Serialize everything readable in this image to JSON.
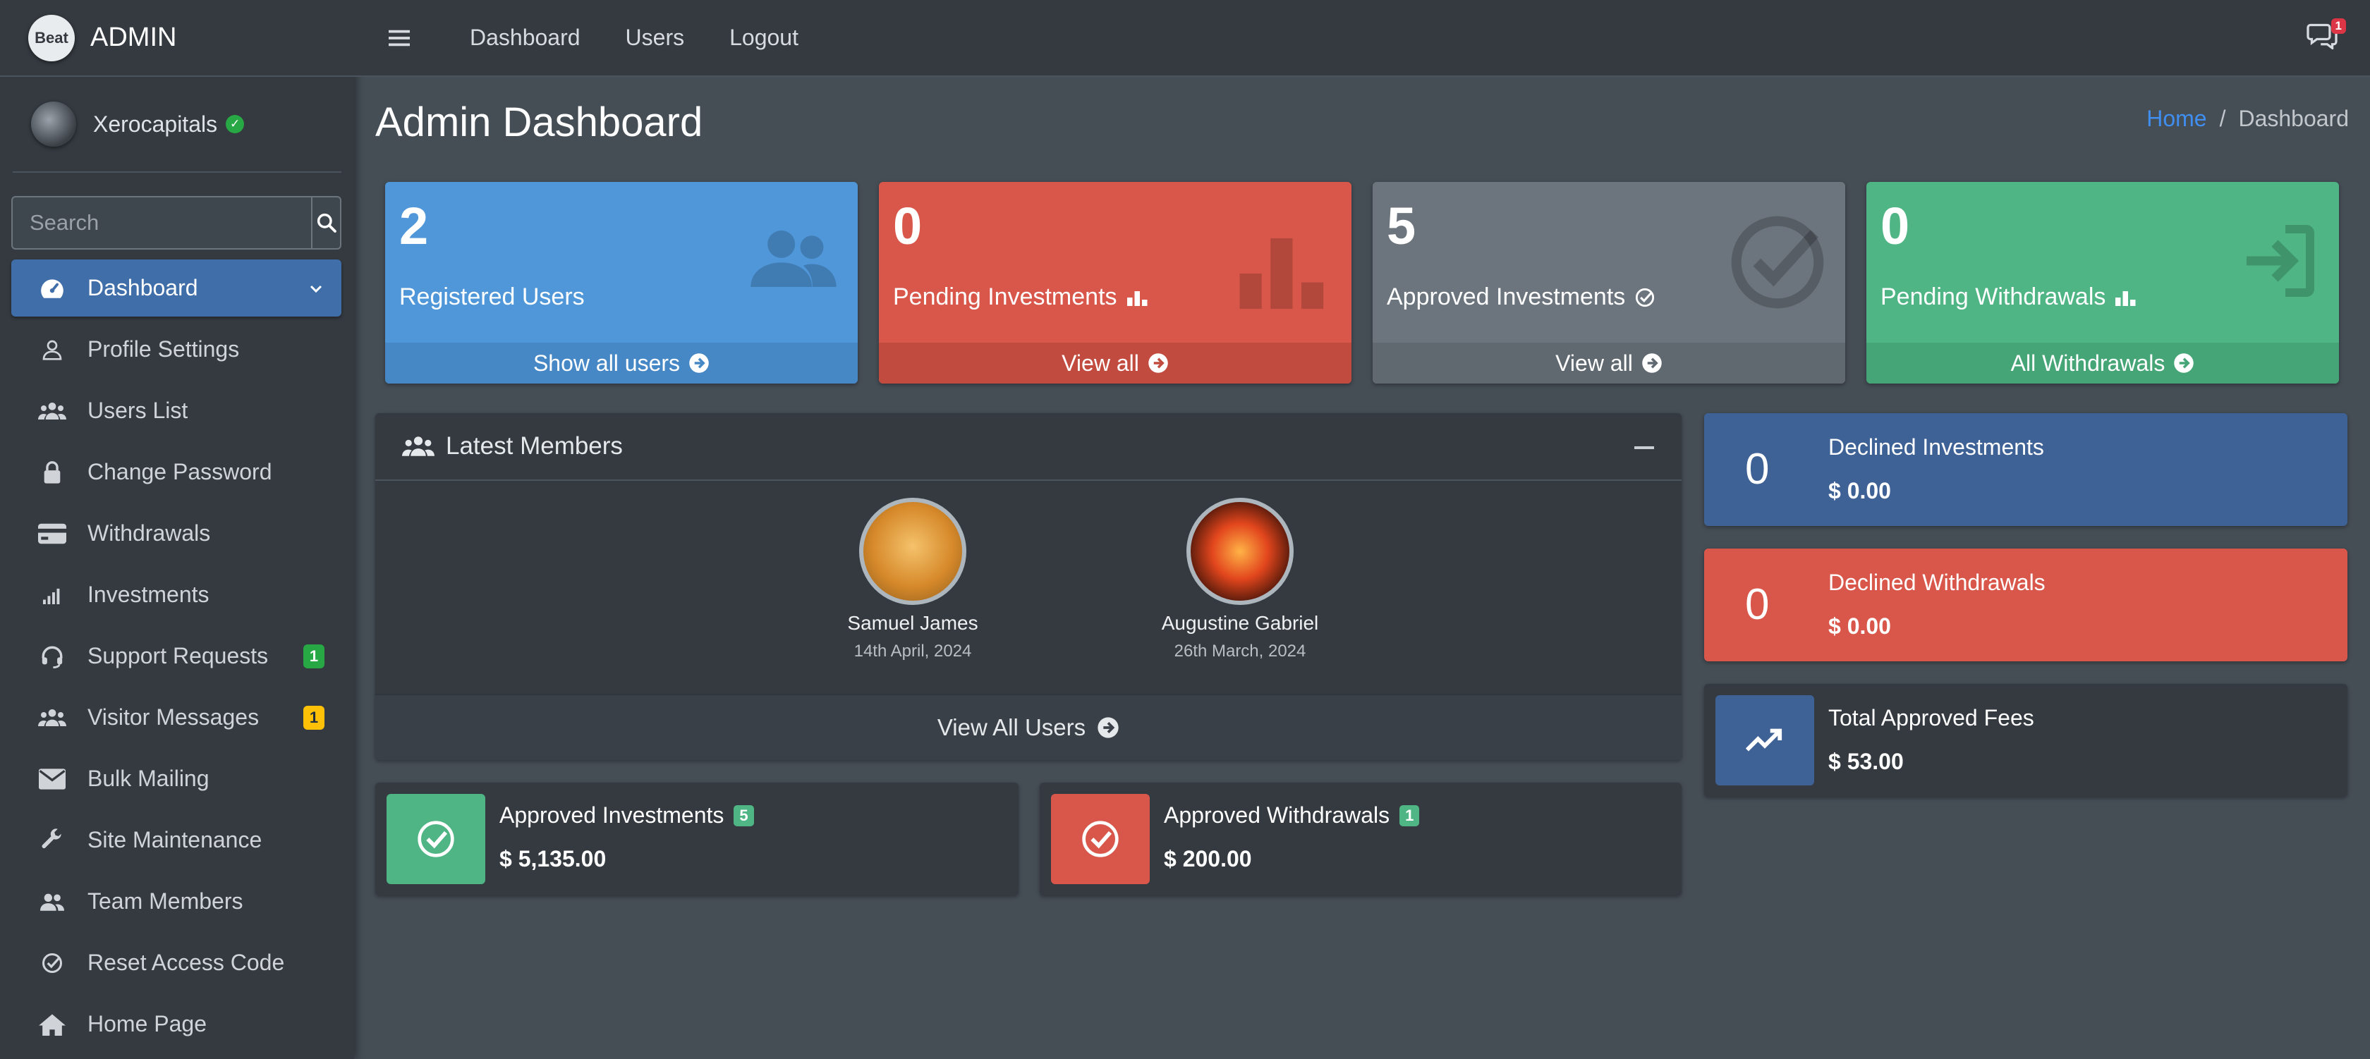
{
  "brand": {
    "logo_text": "Beat",
    "title": "ADMIN"
  },
  "user": {
    "name": "Xerocapitals"
  },
  "search": {
    "placeholder": "Search"
  },
  "sidebar": {
    "items": [
      {
        "label": "Dashboard",
        "icon": "tachometer-icon"
      },
      {
        "label": "Profile Settings",
        "icon": "user-icon"
      },
      {
        "label": "Users List",
        "icon": "users-icon"
      },
      {
        "label": "Change Password",
        "icon": "lock-icon"
      },
      {
        "label": "Withdrawals",
        "icon": "credit-card-icon"
      },
      {
        "label": "Investments",
        "icon": "signal-icon"
      },
      {
        "label": "Support Requests",
        "icon": "headset-icon",
        "badge": "1"
      },
      {
        "label": "Visitor Messages",
        "icon": "users-icon",
        "badge": "1"
      },
      {
        "label": "Bulk Mailing",
        "icon": "envelope-icon"
      },
      {
        "label": "Site Maintenance",
        "icon": "wrench-icon"
      },
      {
        "label": "Team Members",
        "icon": "team-icon"
      },
      {
        "label": "Reset Access Code",
        "icon": "check-circle-icon"
      },
      {
        "label": "Home Page",
        "icon": "home-icon"
      }
    ]
  },
  "topbar": {
    "links": [
      "Dashboard",
      "Users",
      "Logout"
    ],
    "messages_badge": "1"
  },
  "page": {
    "title": "Admin Dashboard",
    "breadcrumb_home": "Home",
    "breadcrumb_sep": "/",
    "breadcrumb_current": "Dashboard"
  },
  "stats": [
    {
      "value": "2",
      "label": "Registered Users",
      "footer": "Show all users",
      "color": "#4f97d9"
    },
    {
      "value": "0",
      "label": "Pending Investments",
      "footer": "View all",
      "color": "#d9574a"
    },
    {
      "value": "5",
      "label": "Approved Investments",
      "footer": "View all",
      "color": "#6c757d"
    },
    {
      "value": "0",
      "label": "Pending Withdrawals",
      "footer": "All Withdrawals",
      "color": "#4fb584"
    }
  ],
  "members_card": {
    "title": "Latest Members",
    "members": [
      {
        "name": "Samuel James",
        "date": "14th April, 2024"
      },
      {
        "name": "Augustine Gabriel",
        "date": "26th March, 2024"
      }
    ],
    "footer": "View All Users"
  },
  "approved": [
    {
      "label": "Approved Investments",
      "badge": "5",
      "value": "$ 5,135.00",
      "color": "#4fb584"
    },
    {
      "label": "Approved Withdrawals",
      "badge": "1",
      "value": "$ 200.00",
      "color": "#d9574a"
    }
  ],
  "right_boxes": [
    {
      "number": "0",
      "label": "Declined Investments",
      "value": "$ 0.00",
      "color": "#3f6296"
    },
    {
      "number": "0",
      "label": "Declined Withdrawals",
      "value": "$ 0.00",
      "color": "#d9574a"
    },
    {
      "label": "Total Approved Fees",
      "value": "$ 53.00",
      "icon": "chart-line-icon",
      "color": "#3f6296"
    }
  ]
}
